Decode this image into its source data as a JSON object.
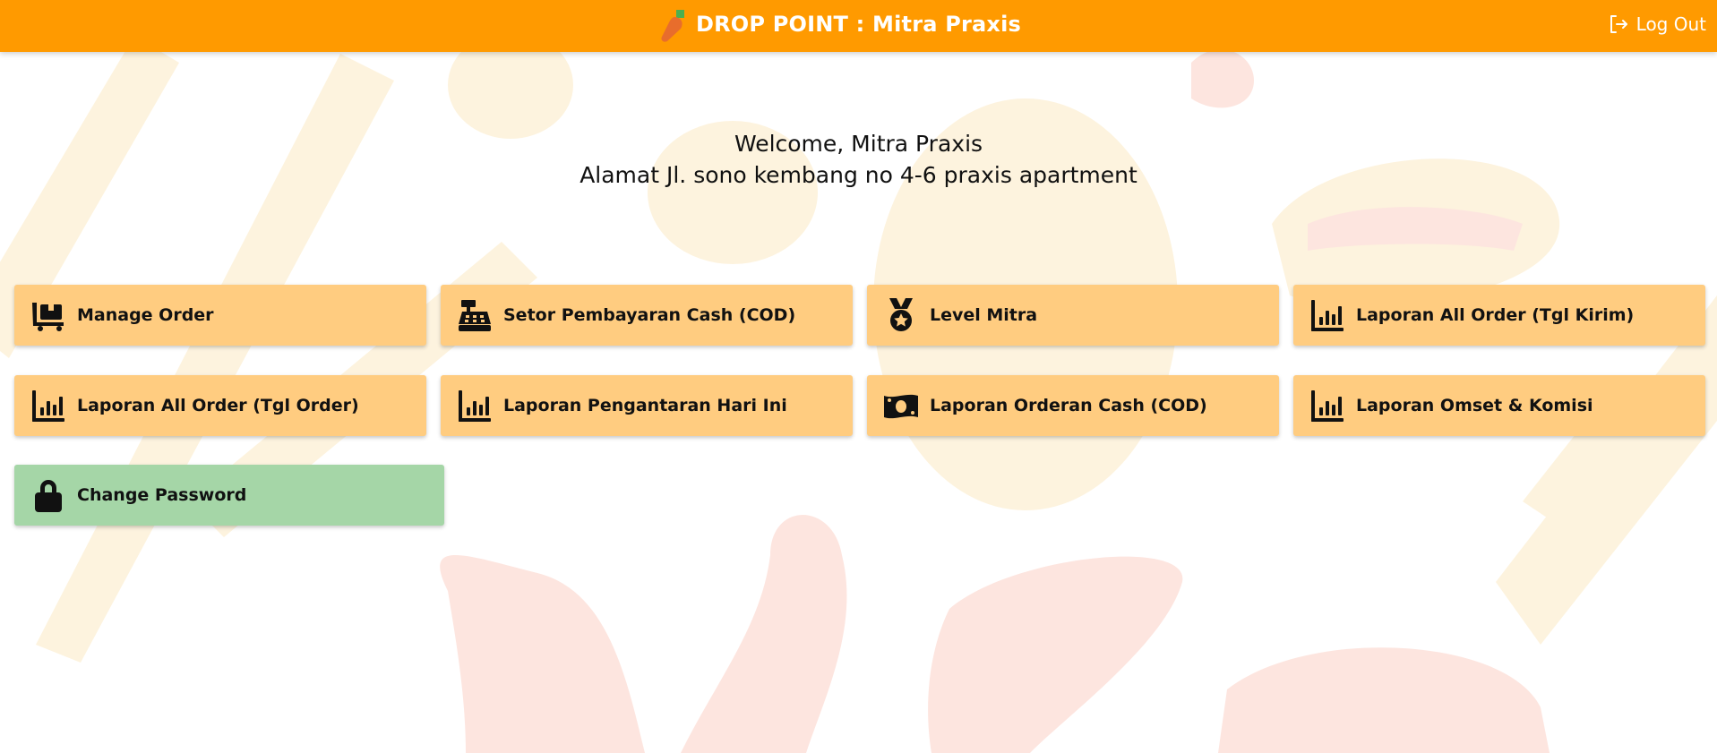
{
  "header": {
    "title": "DROP POINT : Mitra Praxis",
    "logout_label": "Log Out",
    "logo_icon": "carrot-logo-icon",
    "bar_color": "#ff9a00"
  },
  "welcome": {
    "line1": "Welcome, Mitra Praxis",
    "line2": "Alamat Jl. sono kembang no 4-6 praxis apartment"
  },
  "menu": {
    "card_color": "#ffcc80",
    "accent_card_color": "#a5d6a7",
    "items": [
      {
        "label": "Manage Order",
        "icon": "dolly-boxes-icon"
      },
      {
        "label": "Setor Pembayaran Cash (COD)",
        "icon": "cash-register-icon"
      },
      {
        "label": "Level Mitra",
        "icon": "medal-icon"
      },
      {
        "label": "Laporan All Order (Tgl Kirim)",
        "icon": "bar-chart-icon"
      },
      {
        "label": "Laporan All Order (Tgl Order)",
        "icon": "bar-chart-icon"
      },
      {
        "label": "Laporan Pengantaran Hari Ini",
        "icon": "bar-chart-icon"
      },
      {
        "label": "Laporan Orderan Cash (COD)",
        "icon": "money-bill-icon"
      },
      {
        "label": "Laporan Omset & Komisi",
        "icon": "bar-chart-icon"
      },
      {
        "label": "Change Password",
        "icon": "lock-icon"
      }
    ]
  }
}
